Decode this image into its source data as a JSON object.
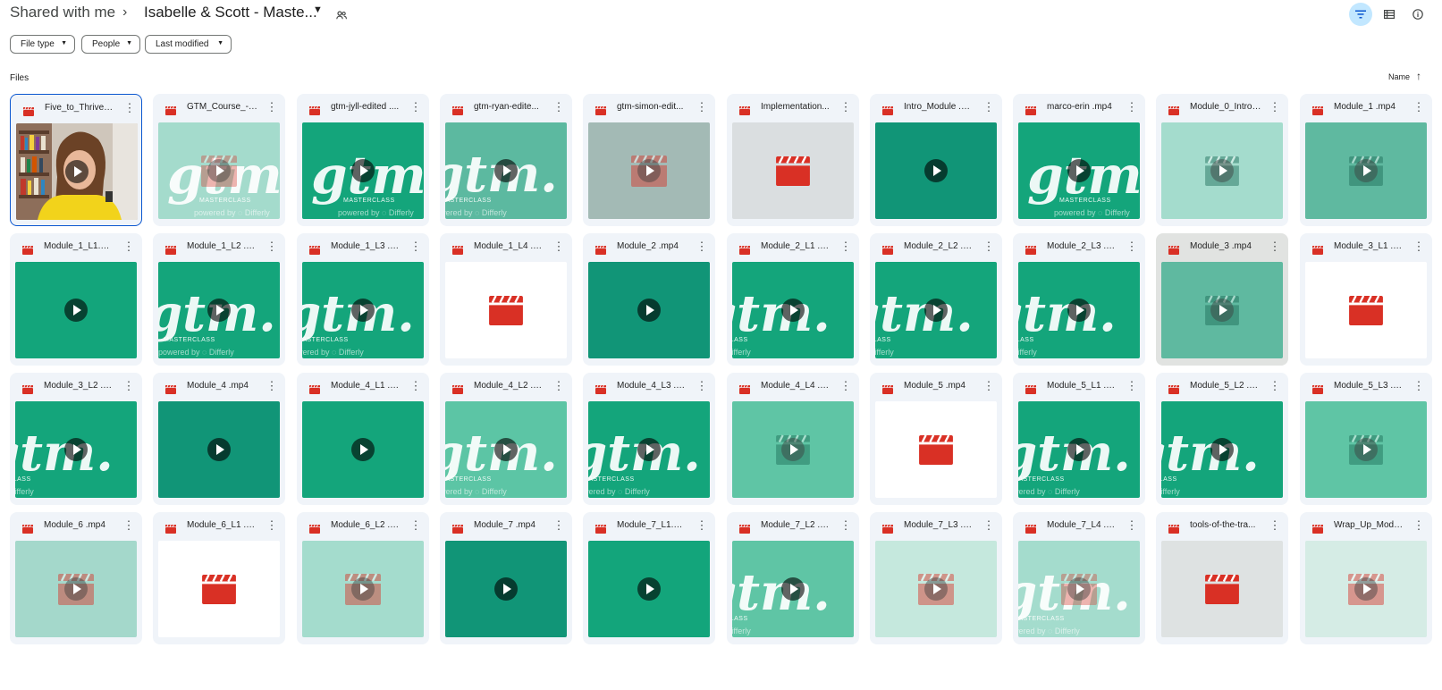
{
  "breadcrumb": {
    "root": "Shared with me",
    "separator": "›",
    "folder": "Isabelle & Scott - Maste..."
  },
  "header_icons": [
    "filter-icon",
    "list-view-icon",
    "info-icon"
  ],
  "filters": {
    "file_type": "File type",
    "people": "People",
    "last_modified": "Last modified"
  },
  "section": {
    "files_label": "Files",
    "sort_label": "Name",
    "sort_direction": "ascending"
  },
  "colors": {
    "accent": "#0b57d0",
    "active_button": "#c2e7ff",
    "video_icon": "#d93025",
    "card_bg": "#f0f4f9"
  },
  "files": [
    {
      "name": "Five_to_Thrive_-...",
      "thumb": "photo",
      "selected": true
    },
    {
      "name": "GTM_Course_-_I...",
      "thumb": "gtm-light",
      "bg": "#a4dbcc"
    },
    {
      "name": "gtm-jyll-edited ....",
      "thumb": "gtm-full",
      "bg": "#14a57b"
    },
    {
      "name": "gtm-ryan-edite...",
      "thumb": "gtm-left",
      "bg": "#5cb9a0"
    },
    {
      "name": "gtm-simon-edit...",
      "thumb": "gray-clap",
      "bg": "#a3bab5"
    },
    {
      "name": "Implementation...",
      "thumb": "clap-gray",
      "bg": "#dadee0"
    },
    {
      "name": "Intro_Module .m...",
      "thumb": "plain",
      "bg": "#119577"
    },
    {
      "name": "marco-erin .mp4",
      "thumb": "gtm-full",
      "bg": "#14a57b"
    },
    {
      "name": "Module_0_Intro ...",
      "thumb": "plain-dim",
      "bg": "#a4dccd"
    },
    {
      "name": "Module_1 .mp4",
      "thumb": "plain-dim",
      "bg": "#5fb9a0"
    },
    {
      "name": "Module_1_L1.mp4",
      "thumb": "plain",
      "bg": "#13a57b"
    },
    {
      "name": "Module_1_L2 .m...",
      "thumb": "gtm-mid",
      "bg": "#14a57b"
    },
    {
      "name": "Module_1_L3 .m...",
      "thumb": "gtm-left",
      "bg": "#14a57b"
    },
    {
      "name": "Module_1_L4 .m...",
      "thumb": "clap-white",
      "bg": "#ffffff"
    },
    {
      "name": "Module_2 .mp4",
      "thumb": "plain",
      "bg": "#119577"
    },
    {
      "name": "Module_2_L1 .m...",
      "thumb": "gtm-edge",
      "bg": "#14a57b"
    },
    {
      "name": "Module_2_L2 .m...",
      "thumb": "gtm-edge",
      "bg": "#14a57b"
    },
    {
      "name": "Module_2_L3 .m...",
      "thumb": "gtm-edge",
      "bg": "#14a57b"
    },
    {
      "name": "Module_3 .mp4",
      "thumb": "plain-dim",
      "bg": "#5fb9a0",
      "hovered": true
    },
    {
      "name": "Module_3_L1 .m...",
      "thumb": "clap-white",
      "bg": "#ffffff"
    },
    {
      "name": "Module_3_L2 .m...",
      "thumb": "gtm-edge",
      "bg": "#14a57b"
    },
    {
      "name": "Module_4 .mp4",
      "thumb": "plain",
      "bg": "#119577"
    },
    {
      "name": "Module_4_L1 .m...",
      "thumb": "plain",
      "bg": "#14a57b"
    },
    {
      "name": "Module_4_L2 .m...",
      "thumb": "gtm-left",
      "bg": "#5cc5a5"
    },
    {
      "name": "Module_4_L3 .m...",
      "thumb": "gtm-left",
      "bg": "#14a57b"
    },
    {
      "name": "Module_4_L4 .m...",
      "thumb": "plain-dim",
      "bg": "#5fc5a5"
    },
    {
      "name": "Module_5 .mp4",
      "thumb": "clap-white",
      "bg": "#ffffff"
    },
    {
      "name": "Module_5_L1 .m...",
      "thumb": "gtm-left",
      "bg": "#14a57b"
    },
    {
      "name": "Module_5_L2 .m...",
      "thumb": "gtm-edge",
      "bg": "#14a57b"
    },
    {
      "name": "Module_5_L3 .m...",
      "thumb": "plain-dim",
      "bg": "#5fc5a5"
    },
    {
      "name": "Module_6 .mp4",
      "thumb": "gray-clap",
      "bg": "#a4d8cb"
    },
    {
      "name": "Module_6_L1 .m...",
      "thumb": "clap-white",
      "bg": "#ffffff"
    },
    {
      "name": "Module_6_L2 .m...",
      "thumb": "gray-clap",
      "bg": "#a4dccd"
    },
    {
      "name": "Module_7 .mp4",
      "thumb": "plain",
      "bg": "#119577"
    },
    {
      "name": "Module_7_L1.mp4",
      "thumb": "plain",
      "bg": "#13a57b"
    },
    {
      "name": "Module_7_L2 .m...",
      "thumb": "gtm-edge",
      "bg": "#5fc5a5"
    },
    {
      "name": "Module_7_L3 .m...",
      "thumb": "clap-pale",
      "bg": "#c5e8dd"
    },
    {
      "name": "Module_7_L4 .m...",
      "thumb": "gtm-left-pale",
      "bg": "#a4dccd"
    },
    {
      "name": "tools-of-the-tra...",
      "thumb": "clap-gray",
      "bg": "#dee2e2"
    },
    {
      "name": "Wrap_Up_Modul...",
      "thumb": "clap-pale",
      "bg": "#d5ece5"
    }
  ],
  "thumb_text": {
    "logo": "gtm.",
    "masterclass": "MASTERCLASS",
    "powered_by": "powered by ◌ Differly"
  }
}
